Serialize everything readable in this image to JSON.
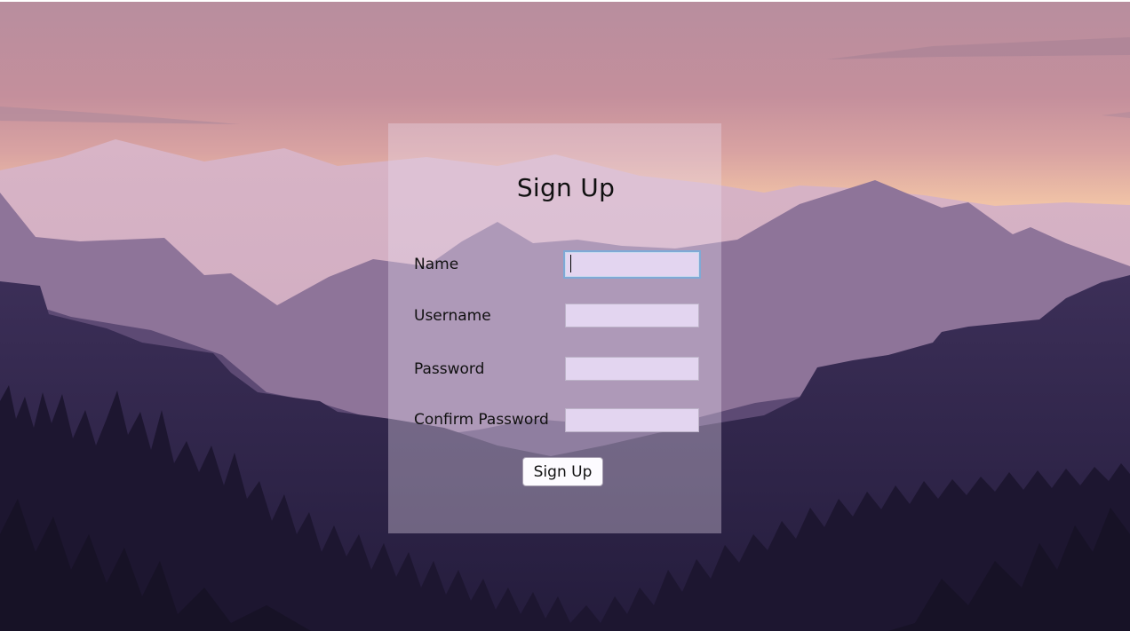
{
  "form": {
    "title": "Sign Up",
    "fields": [
      {
        "label": "Name",
        "value": "",
        "focused": true
      },
      {
        "label": "Username",
        "value": ""
      },
      {
        "label": "Password",
        "value": ""
      },
      {
        "label": "Confirm Password",
        "value": ""
      }
    ],
    "submit_label": "Sign Up"
  },
  "colors": {
    "sky_top": "#b88e9e",
    "sky_glow": "#f0c2a6",
    "mountain_far": "#c79fb3",
    "mountain_mid": "#8d7598",
    "mountain_near": "#2e2448",
    "forest": "#1d1630",
    "input_fill": "#e3d5f0",
    "focus_ring": "#7fa9d6"
  }
}
